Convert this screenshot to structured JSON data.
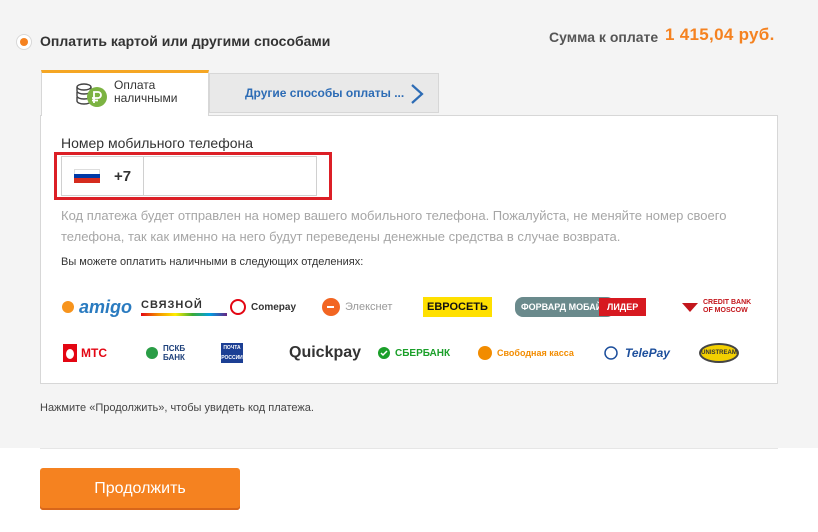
{
  "payment": {
    "method_title": "Оплатить картой или другими способами",
    "amount_label": "Сумма к оплате",
    "amount_value": "1 415,04 руб."
  },
  "tabs": [
    {
      "label_line1": "Оплата",
      "label_line2": "наличными",
      "icon": "coin-stack-ruble-icon",
      "active": true
    },
    {
      "label": "Другие способы оплаты ...",
      "icon": "chevron-right-icon",
      "active": false
    }
  ],
  "form": {
    "phone_label": "Номер мобильного телефона",
    "country_code": "+7",
    "country_flag": "russia-flag-icon",
    "phone_value": "",
    "hint": "Код платежа будет отправлен на номер вашего мобильного телефона. Пожалуйста, не меняйте номер своего телефона, так как именно на него будут переведены денежные средства в случае возврата.",
    "branches_label": "Вы можете оплатить наличными в следующих отделениях:"
  },
  "providers": {
    "amigo": "amigo",
    "svyaznoy": "СВЯЗНОЙ",
    "comepay": "Comepay",
    "eleksnet": "Элекснет",
    "evroset": "ЕВРОСЕТЬ",
    "forward": "ФОРВАРД МОБАЙЛ",
    "lider": "ЛИДЕР",
    "cbm_line1": "CREDIT BANK",
    "cbm_line2": "OF MOSCOW",
    "mts": "МТС",
    "pskb_line1": "ПСКБ",
    "pskb_line2": "БАНК",
    "pochta_line1": "ПОЧТА",
    "pochta_line2": "РОССИИ",
    "quickpay": "Quickpay",
    "sberbank": "СБЕРБАНК",
    "svobodnaya": "Свободная касса",
    "telepay": "TelePay",
    "unistream": "UNISTREAM"
  },
  "note": "Нажмите «Продолжить», чтобы увидеть код платежа.",
  "actions": {
    "continue_label": "Продолжить"
  },
  "colors": {
    "accent": "#f58220",
    "highlight": "#dc1f26",
    "link": "#2d6cb5",
    "tab_top": "#f5a623"
  }
}
